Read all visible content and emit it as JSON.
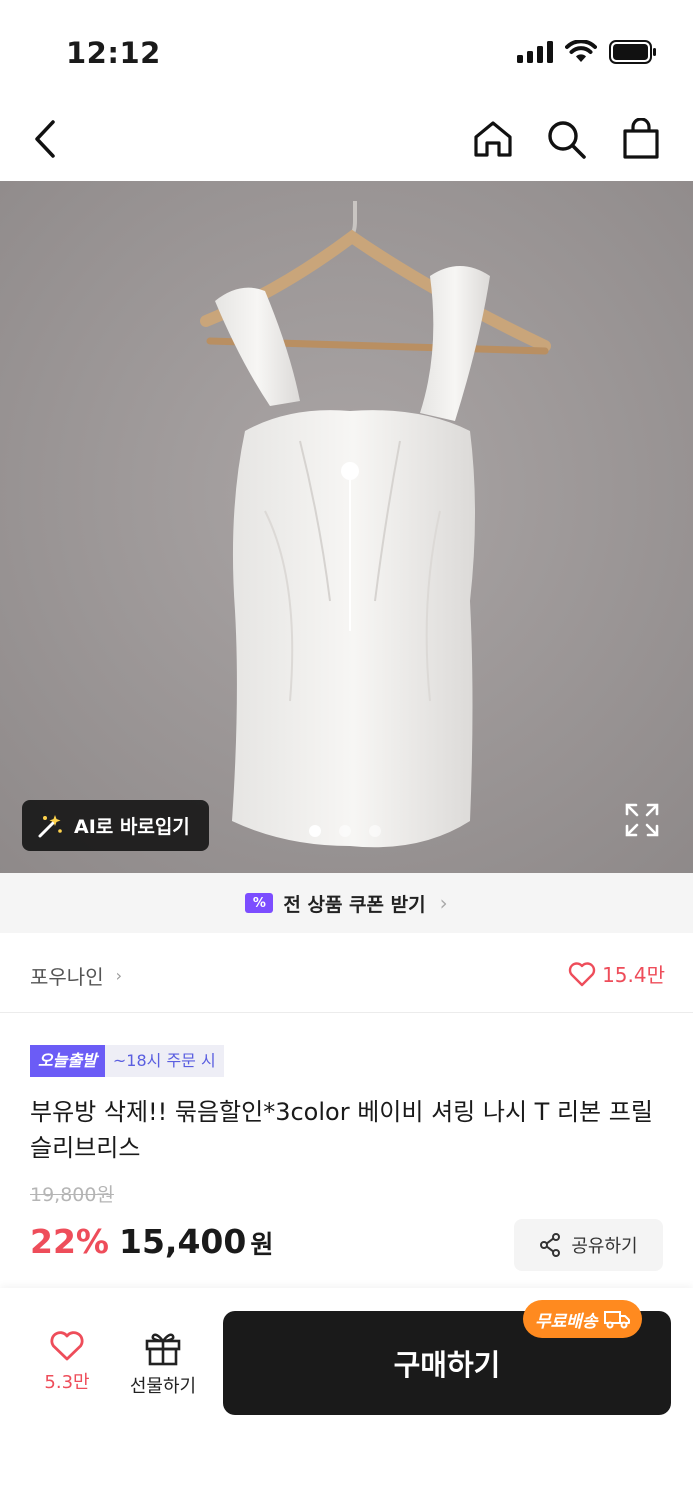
{
  "status_bar": {
    "time": "12:12"
  },
  "hero": {
    "ai_try_label": "AI로 바로입기",
    "page_count": 3,
    "active_page": 1
  },
  "coupon": {
    "label": "전 상품 쿠폰 받기",
    "icon": "%"
  },
  "shop": {
    "name": "포우나인",
    "likes": "15.4만"
  },
  "badges": {
    "today_ship": "오늘출발",
    "cutoff": "~18시 주문 시"
  },
  "product": {
    "title": "부유방 삭제!! 묶음할인*3color 베이비 셔링 나시 T 리본 프릴 슬리브리스",
    "original_price": "19,800원",
    "discount": "22%",
    "price": "15,400",
    "price_unit": "원"
  },
  "share": {
    "label": "공유하기"
  },
  "bottom": {
    "wish_count": "5.3만",
    "gift_label": "선물하기",
    "buy_label": "구매하기",
    "free_ship": "무료배송"
  },
  "colors": {
    "accent_red": "#ee4d5a",
    "purple": "#6b5cf6",
    "orange": "#ff8a1f",
    "dark": "#1a1a1a"
  }
}
